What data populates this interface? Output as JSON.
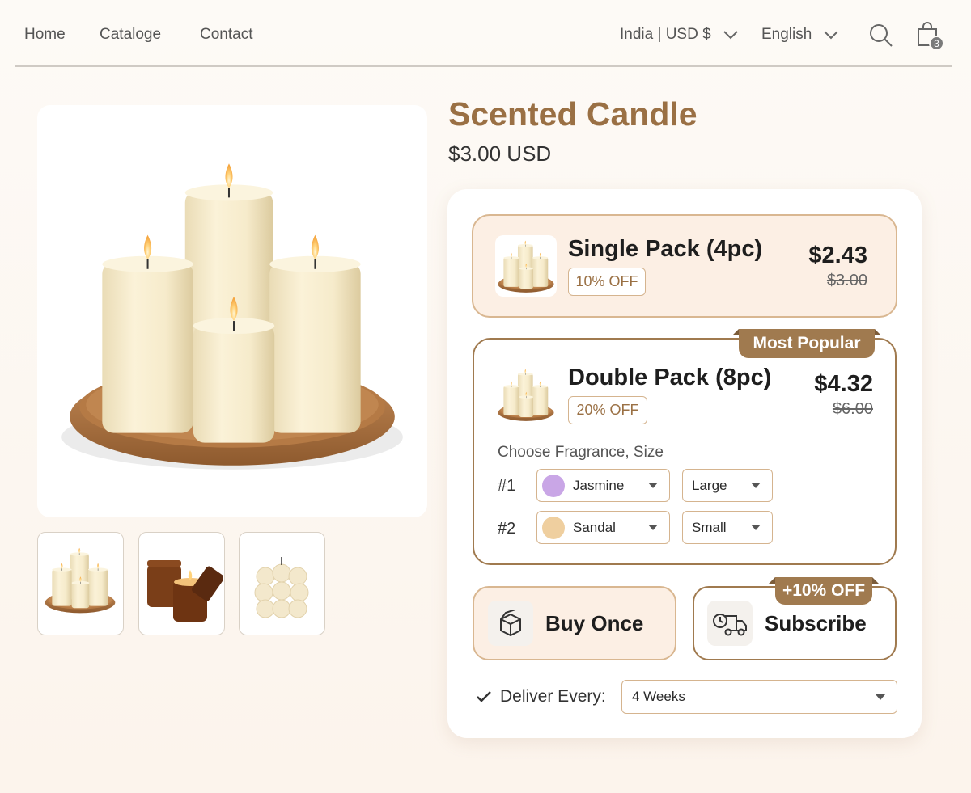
{
  "nav": {
    "links": [
      "Home",
      "Cataloge",
      "Contact"
    ],
    "region": "India | USD $",
    "language": "English",
    "cart_count": "3"
  },
  "product": {
    "title": "Scented Candle",
    "price": "$3.00 USD"
  },
  "packs": {
    "single": {
      "name": "Single Pack (4pc)",
      "discount": "10% OFF",
      "price": "$2.43",
      "original_price": "$3.00"
    },
    "double": {
      "name": "Double Pack (8pc)",
      "discount": "20% OFF",
      "price": "$4.32",
      "original_price": "$6.00",
      "ribbon": "Most Popular",
      "choose_label": "Choose Fragrance, Size",
      "rows": [
        {
          "num": "#1",
          "fragrance": "Jasmine",
          "swatch": "#c9a6e6",
          "size": "Large"
        },
        {
          "num": "#2",
          "fragrance": "Sandal",
          "swatch": "#efcf9f",
          "size": "Small"
        }
      ]
    }
  },
  "purchase": {
    "buy_once": "Buy Once",
    "subscribe": "Subscribe",
    "subscribe_ribbon": "+10% OFF",
    "deliver_label": "Deliver Every:",
    "deliver_value": "4 Weeks"
  },
  "colors": {
    "accent": "#a07a4f",
    "title": "#9a7044",
    "soft_fill": "#fcefe4"
  }
}
